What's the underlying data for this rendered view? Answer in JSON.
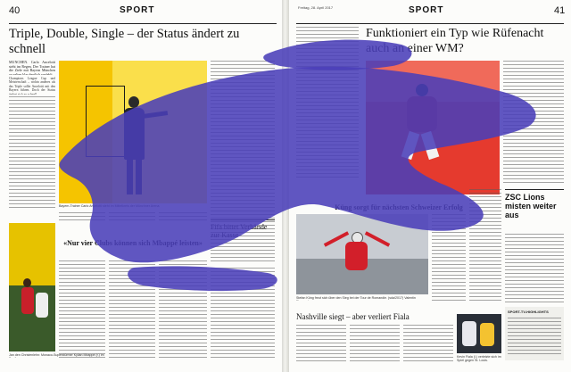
{
  "spread": {
    "left": {
      "page_number": "40",
      "section": "SPORT",
      "headline": "Triple, Double, Single – der Status ändert zu schnell",
      "lead_text": "MÜNCHEN. Carlo Ancelotti steht im Regen. Der Trainer hat die Ziele mit Bayern München zu selten klar deutlich verfehlt.",
      "body_excerpt": "Champions League Cup und Meisterschaft – wohin anderes als das Triple sollte Ancelotti mit den Bayern führen. Doch der Status ändert sich zu schnell.",
      "photo_caption": "Bayern-Trainer Carlo Ancelotti steht im Mittelkreis der Münchner Arena.",
      "subhead": "«Nur vier Clubs können sich Mbappé leisten»",
      "photo_caption_2": "Jan den Christenlehn: Monaco-Superstürmer Kylian Mbappé (r.) im Duell.",
      "box_headline": "Fifa bittet Verbände zur Kasse"
    },
    "right": {
      "page_number": "41",
      "section": "SPORT",
      "date_line": "Freitag, 28. April 2017",
      "headline": "Funktioniert ein Typ wie Rüfenacht auch an einer WM?",
      "subhead": "Küng sorgt für nächsten Schweizer Erfolg",
      "photo_caption": "Stefan Küng freut sich über den Sieg bei der Tour de Romandie. (sda/2017) Valentin Flauraud",
      "box_headline": "ZSC Lions misten weiter aus",
      "bottom_headline": "Nashville siegt – aber verliert Fiala",
      "sidebar_label": "SPORT-TV-HIGHLIGHTS",
      "bottom_caption": "Kevin Fiala (l.) verletzte sich im Spiel gegen St. Louis."
    }
  },
  "overlay": {
    "color": "#4a3fb8",
    "opacity": 0.88
  }
}
